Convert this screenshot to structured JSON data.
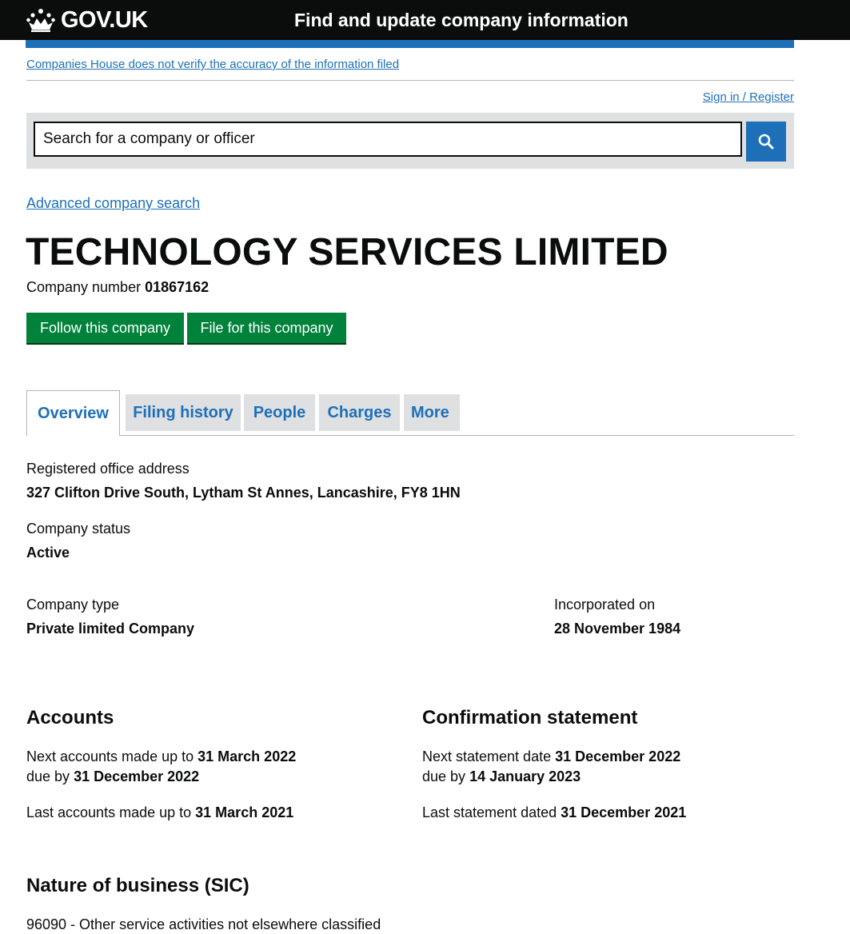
{
  "header": {
    "logo_text": "GOV.UK",
    "service_name": "Find and update company information"
  },
  "disclaimer": "Companies House does not verify the accuracy of the information filed",
  "signin": "Sign in / Register",
  "search": {
    "placeholder": "Search for a company or officer"
  },
  "advanced_search": "Advanced company search",
  "company": {
    "name": "TECHNOLOGY SERVICES LIMITED",
    "number_label": "Company number",
    "number": "01867162"
  },
  "buttons": {
    "follow": "Follow this company",
    "file": "File for this company"
  },
  "tabs": [
    "Overview",
    "Filing history",
    "People",
    "Charges",
    "More"
  ],
  "overview": {
    "registered_office_label": "Registered office address",
    "registered_office": "327 Clifton Drive South, Lytham St Annes, Lancashire, FY8 1HN",
    "status_label": "Company status",
    "status": "Active",
    "type_label": "Company type",
    "type": "Private limited Company",
    "incorporated_label": "Incorporated on",
    "incorporated": "28 November 1984"
  },
  "accounts": {
    "heading": "Accounts",
    "next_made_up_label": "Next accounts made up to",
    "next_made_up": "31 March 2022",
    "due_by_label": "due by",
    "due_by": "31 December 2022",
    "last_made_up_label": "Last accounts made up to",
    "last_made_up": "31 March 2021"
  },
  "confirmation": {
    "heading": "Confirmation statement",
    "next_date_label": "Next statement date",
    "next_date": "31 December 2022",
    "due_by_label": "due by",
    "due_by": "14 January 2023",
    "last_dated_label": "Last statement dated",
    "last_dated": "31 December 2021"
  },
  "sic": {
    "heading": "Nature of business (SIC)",
    "item": "96090 - Other service activities not elsewhere classified"
  },
  "colors": {
    "header_bg": "#0b0c0c",
    "link": "#1d70b8",
    "button_green": "#00823b",
    "tab_bg": "#dee0e2"
  }
}
